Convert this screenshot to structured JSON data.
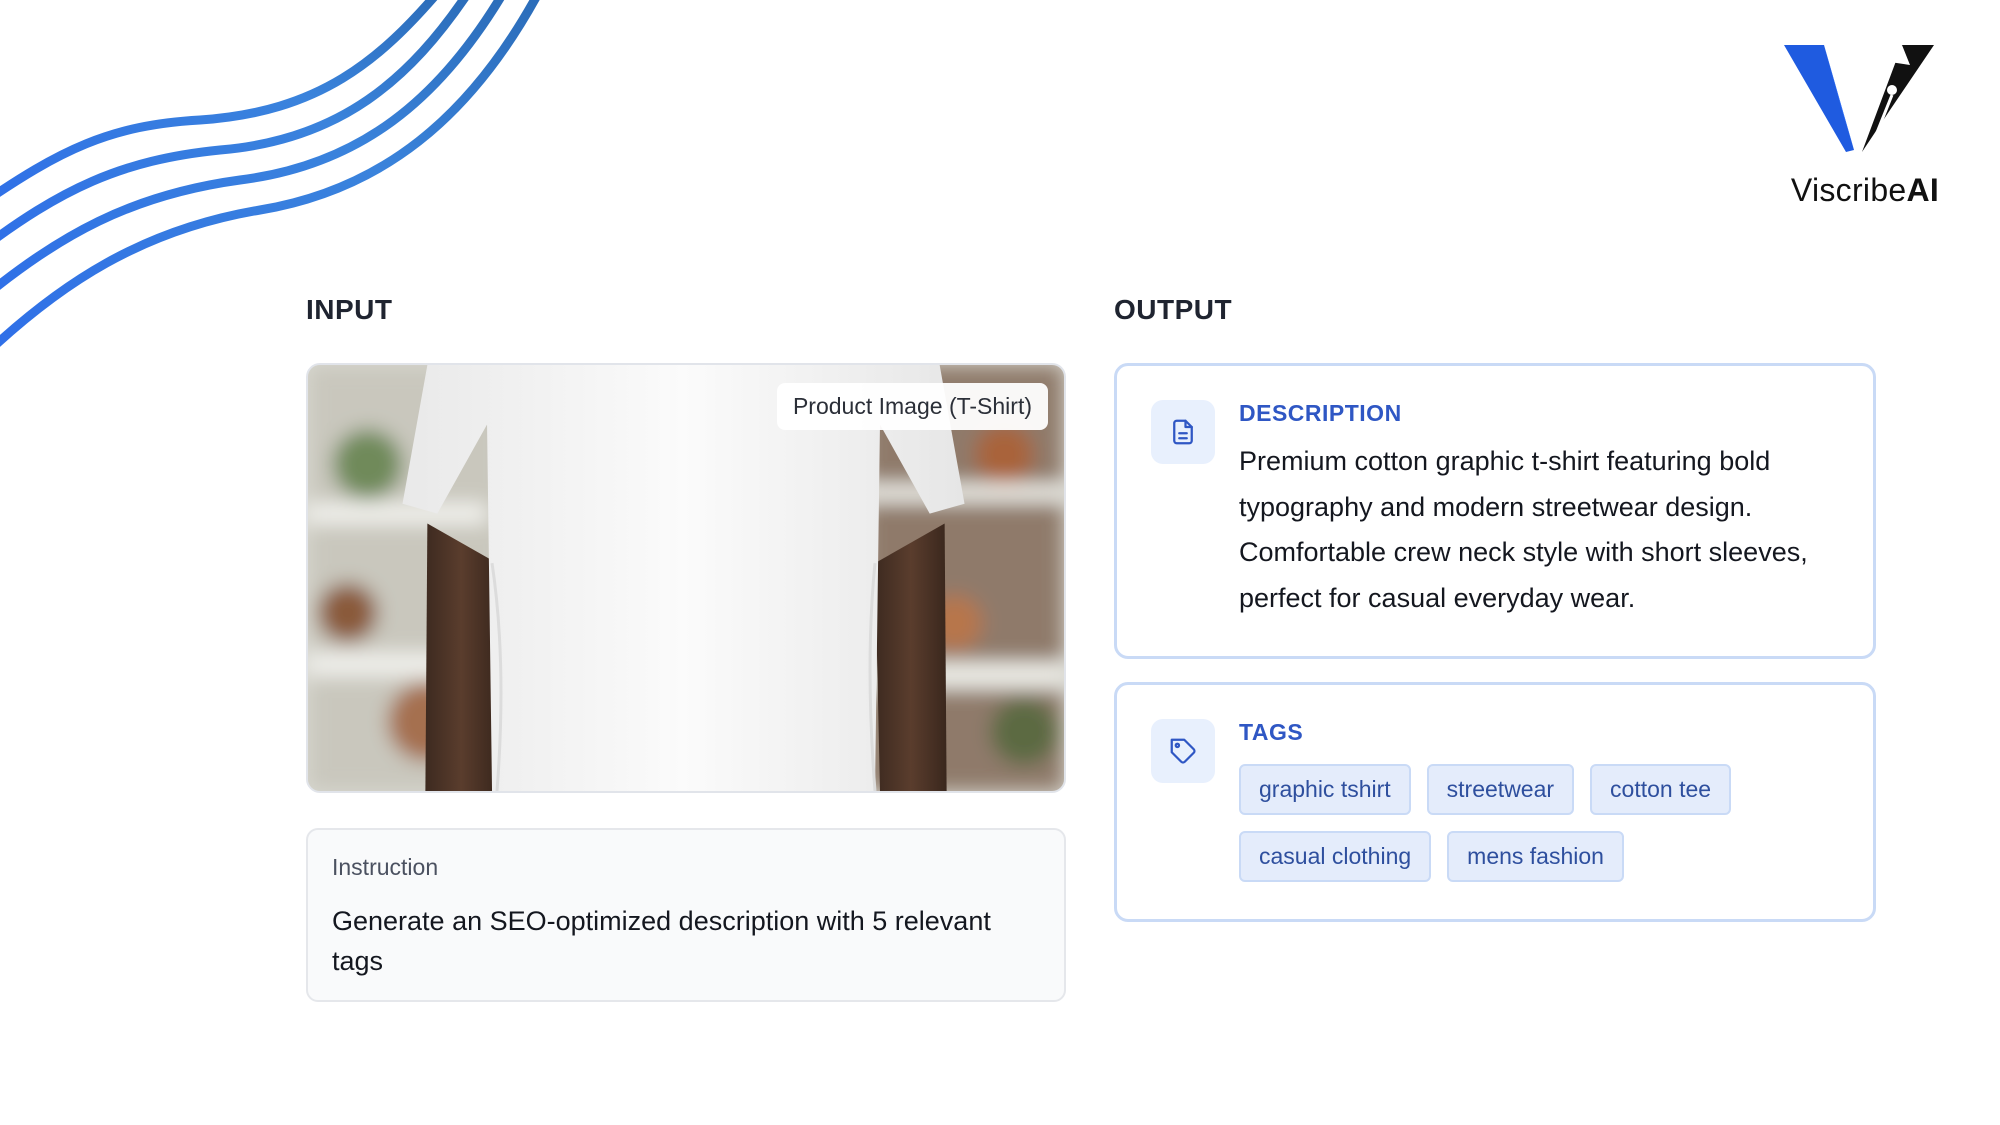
{
  "brand": {
    "name_regular": "Viscribe",
    "name_bold": "AI",
    "logo_icon": "v-pen-nib-logo"
  },
  "decoration": {
    "wave_colors": [
      "#2f6fe8",
      "#3a83dc",
      "#2b6cb8"
    ]
  },
  "input": {
    "title": "INPUT",
    "image_badge": "Product Image (T-Shirt)",
    "instruction_label": "Instruction",
    "instruction_text": "Generate an SEO-optimized description with 5 relevant tags"
  },
  "output": {
    "title": "OUTPUT",
    "description": {
      "label": "DESCRIPTION",
      "icon": "document-icon",
      "text": "Premium cotton graphic t-shirt featuring bold typography and modern streetwear design. Comfortable crew neck style with short sleeves, perfect for casual everyday wear."
    },
    "tags": {
      "label": "TAGS",
      "icon": "tag-icon",
      "items": [
        "graphic tshirt",
        "streetwear",
        "cotton tee",
        "casual clothing",
        "mens fashion"
      ]
    }
  },
  "colors": {
    "accent": "#2f57c4",
    "card_border": "#c9daf6",
    "tag_bg": "#e4ecfb"
  }
}
